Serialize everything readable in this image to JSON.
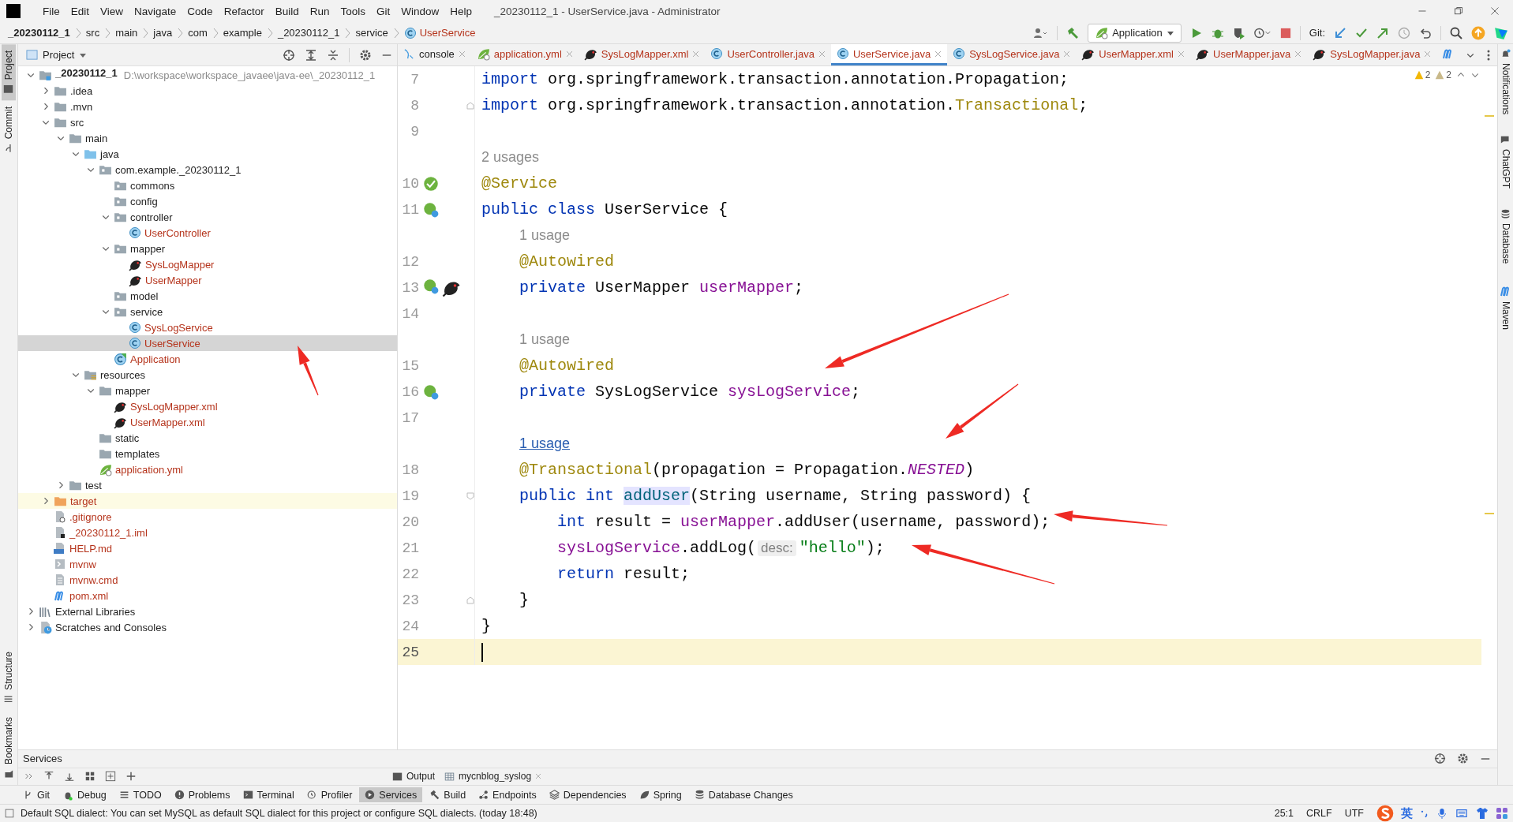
{
  "menu": [
    "File",
    "Edit",
    "View",
    "Navigate",
    "Code",
    "Refactor",
    "Build",
    "Run",
    "Tools",
    "Git",
    "Window",
    "Help"
  ],
  "window": {
    "title": "_20230112_1 - UserService.java - Administrator"
  },
  "breadcrumbs": [
    {
      "label": "_20230112_1",
      "kind": "project"
    },
    {
      "label": "src",
      "kind": "folder"
    },
    {
      "label": "main",
      "kind": "folder"
    },
    {
      "label": "java",
      "kind": "folder"
    },
    {
      "label": "com",
      "kind": "folder"
    },
    {
      "label": "example",
      "kind": "folder"
    },
    {
      "label": "_20230112_1",
      "kind": "folder"
    },
    {
      "label": "service",
      "kind": "folder"
    },
    {
      "label": "UserService",
      "kind": "class"
    }
  ],
  "run_config": {
    "label": "Application"
  },
  "git_label": "Git:",
  "left_toolbar": {
    "top": [
      {
        "label": "Project",
        "selected": true
      },
      {
        "label": "Commit",
        "selected": false
      }
    ],
    "bottom": [
      {
        "label": "Structure",
        "selected": false
      },
      {
        "label": "Bookmarks",
        "selected": false
      }
    ]
  },
  "right_toolbar": [
    {
      "label": "Notifications",
      "kind": "bell"
    },
    {
      "label": "ChatGPT",
      "kind": "chat"
    },
    {
      "label": "Database",
      "kind": "database"
    },
    {
      "label": "Maven",
      "kind": "maven"
    }
  ],
  "project_panel": {
    "title": "Project",
    "tree": [
      {
        "label": "_20230112_1",
        "path": "D:\\workspace\\workspace_javaee\\java-ee\\_20230112_1",
        "kind": "module",
        "expanded": true,
        "selected": false,
        "added": false,
        "children": [
          {
            "label": ".idea",
            "kind": "folder",
            "expanded": false,
            "selected": false,
            "added": false
          },
          {
            "label": ".mvn",
            "kind": "folder",
            "expanded": false,
            "selected": false,
            "added": false
          },
          {
            "label": "src",
            "kind": "folder",
            "expanded": true,
            "selected": false,
            "added": false,
            "children": [
              {
                "label": "main",
                "kind": "folder",
                "expanded": true,
                "selected": false,
                "added": false,
                "children": [
                  {
                    "label": "java",
                    "kind": "source-folder",
                    "expanded": true,
                    "selected": false,
                    "added": false,
                    "children": [
                      {
                        "label": "com.example._20230112_1",
                        "kind": "package",
                        "expanded": true,
                        "selected": false,
                        "added": false,
                        "children": [
                          {
                            "label": "commons",
                            "kind": "package",
                            "selected": false,
                            "added": false
                          },
                          {
                            "label": "config",
                            "kind": "package",
                            "selected": false,
                            "added": false
                          },
                          {
                            "label": "controller",
                            "kind": "package",
                            "expanded": true,
                            "selected": false,
                            "added": false,
                            "children": [
                              {
                                "label": "UserController",
                                "kind": "class",
                                "selected": false,
                                "added": true
                              }
                            ]
                          },
                          {
                            "label": "mapper",
                            "kind": "package",
                            "expanded": true,
                            "selected": false,
                            "added": false,
                            "children": [
                              {
                                "label": "SysLogMapper",
                                "kind": "mybatis",
                                "selected": false,
                                "added": true
                              },
                              {
                                "label": "UserMapper",
                                "kind": "mybatis",
                                "selected": false,
                                "added": true
                              }
                            ]
                          },
                          {
                            "label": "model",
                            "kind": "package",
                            "selected": false,
                            "added": false
                          },
                          {
                            "label": "service",
                            "kind": "package",
                            "expanded": true,
                            "selected": false,
                            "added": false,
                            "children": [
                              {
                                "label": "SysLogService",
                                "kind": "class",
                                "selected": false,
                                "added": true
                              },
                              {
                                "label": "UserService",
                                "kind": "class",
                                "selected": true,
                                "added": true
                              }
                            ]
                          },
                          {
                            "label": "Application",
                            "kind": "spring-class",
                            "selected": false,
                            "added": true
                          }
                        ]
                      }
                    ]
                  },
                  {
                    "label": "resources",
                    "kind": "resources-folder",
                    "expanded": true,
                    "selected": false,
                    "added": false,
                    "children": [
                      {
                        "label": "mapper",
                        "kind": "folder",
                        "expanded": true,
                        "selected": false,
                        "added": false,
                        "children": [
                          {
                            "label": "SysLogMapper.xml",
                            "kind": "mybatis",
                            "selected": false,
                            "added": true
                          },
                          {
                            "label": "UserMapper.xml",
                            "kind": "mybatis",
                            "selected": false,
                            "added": true
                          }
                        ]
                      },
                      {
                        "label": "static",
                        "kind": "folder",
                        "selected": false,
                        "added": false
                      },
                      {
                        "label": "templates",
                        "kind": "folder",
                        "selected": false,
                        "added": false
                      },
                      {
                        "label": "application.yml",
                        "kind": "yml",
                        "selected": false,
                        "added": true
                      }
                    ]
                  }
                ]
              },
              {
                "label": "test",
                "kind": "folder",
                "expanded": false,
                "selected": false,
                "added": false
              }
            ]
          },
          {
            "label": "target",
            "kind": "excluded-folder",
            "expanded": false,
            "selected": false,
            "added": true
          },
          {
            "label": ".gitignore",
            "kind": "ignore-file",
            "selected": false,
            "added": true
          },
          {
            "label": "_20230112_1.iml",
            "kind": "iml-file",
            "selected": false,
            "added": true
          },
          {
            "label": "HELP.md",
            "kind": "md-file",
            "selected": false,
            "added": true
          },
          {
            "label": "mvnw",
            "kind": "script-file",
            "selected": false,
            "added": true
          },
          {
            "label": "mvnw.cmd",
            "kind": "text-file",
            "selected": false,
            "added": true
          },
          {
            "label": "pom.xml",
            "kind": "maven",
            "selected": false,
            "added": true
          }
        ]
      },
      {
        "label": "External Libraries",
        "kind": "libraries",
        "expanded": false,
        "selected": false,
        "added": false
      },
      {
        "label": "Scratches and Consoles",
        "kind": "scratches",
        "expanded": false,
        "selected": false,
        "added": false
      }
    ]
  },
  "tabs": [
    {
      "label": "console",
      "kind": "console",
      "selected": false,
      "added": false
    },
    {
      "label": "application.yml",
      "kind": "yml",
      "selected": false,
      "added": true
    },
    {
      "label": "SysLogMapper.xml",
      "kind": "mybatis",
      "selected": false,
      "added": true
    },
    {
      "label": "UserController.java",
      "kind": "class",
      "selected": false,
      "added": true
    },
    {
      "label": "UserService.java",
      "kind": "class",
      "selected": true,
      "added": true
    },
    {
      "label": "SysLogService.java",
      "kind": "class",
      "selected": false,
      "added": true
    },
    {
      "label": "UserMapper.xml",
      "kind": "mybatis",
      "selected": false,
      "added": true
    },
    {
      "label": "UserMapper.java",
      "kind": "mybatis",
      "selected": false,
      "added": true
    },
    {
      "label": "SysLogMapper.java",
      "kind": "mybatis",
      "selected": false,
      "added": true
    },
    {
      "kind": "maven",
      "selected": false
    }
  ],
  "warnings": [
    {
      "kind": "warning",
      "count": "2"
    },
    {
      "kind": "weak-warning",
      "count": "2"
    }
  ],
  "code": [
    {
      "kind": "code",
      "number": "7",
      "current": false,
      "tokens": [
        {
          "text": "import ",
          "kind": "keyword"
        },
        {
          "text": "org.springframework.transaction.annotation.Propagation;",
          "kind": "plain"
        }
      ]
    },
    {
      "kind": "code",
      "number": "8",
      "current": false,
      "gutter": [
        {
          "kind": "fold-end"
        }
      ],
      "tokens": [
        {
          "text": "import ",
          "kind": "keyword"
        },
        {
          "text": "org.springframework.transaction.annotation.",
          "kind": "plain"
        },
        {
          "text": "Transactional",
          "kind": "annotation"
        },
        {
          "text": ";",
          "kind": "plain"
        }
      ]
    },
    {
      "kind": "code",
      "number": "9",
      "current": false
    },
    {
      "kind": "hint",
      "text": "2 usages",
      "link": false
    },
    {
      "kind": "code",
      "number": "10",
      "current": false,
      "gutter": [
        {
          "kind": "bean"
        }
      ],
      "tokens": [
        {
          "text": "@Service",
          "kind": "annotation"
        }
      ]
    },
    {
      "kind": "code",
      "number": "11",
      "current": false,
      "gutter": [
        {
          "kind": "bean-link"
        }
      ],
      "tokens": [
        {
          "text": "public class ",
          "kind": "keyword"
        },
        {
          "text": "UserService {",
          "kind": "plain"
        }
      ]
    },
    {
      "kind": "hint",
      "text": "1 usage",
      "link": false
    },
    {
      "kind": "code",
      "number": "12",
      "current": false,
      "tokens": [
        {
          "text": "    @Autowired",
          "kind": "annotation"
        }
      ]
    },
    {
      "kind": "code",
      "number": "13",
      "current": false,
      "gutter": [
        {
          "kind": "bean-link"
        },
        {
          "kind": "mybatis"
        }
      ],
      "tokens": [
        {
          "text": "    private ",
          "kind": "keyword"
        },
        {
          "text": "UserMapper ",
          "kind": "plain"
        },
        {
          "text": "userMapper",
          "kind": "field"
        },
        {
          "text": ";",
          "kind": "plain"
        }
      ]
    },
    {
      "kind": "code",
      "number": "14",
      "current": false
    },
    {
      "kind": "hint",
      "text": "1 usage",
      "link": false
    },
    {
      "kind": "code",
      "number": "15",
      "current": false,
      "tokens": [
        {
          "text": "    @Autowired",
          "kind": "annotation"
        }
      ]
    },
    {
      "kind": "code",
      "number": "16",
      "current": false,
      "gutter": [
        {
          "kind": "bean-link"
        }
      ],
      "tokens": [
        {
          "text": "    private ",
          "kind": "keyword"
        },
        {
          "text": "SysLogService ",
          "kind": "plain"
        },
        {
          "text": "sysLogService",
          "kind": "field"
        },
        {
          "text": ";",
          "kind": "plain"
        }
      ]
    },
    {
      "kind": "code",
      "number": "17",
      "current": false
    },
    {
      "kind": "hint",
      "text": "1 usage",
      "link": true
    },
    {
      "kind": "code",
      "number": "18",
      "current": false,
      "tokens": [
        {
          "text": "    @Transactional",
          "kind": "annotation"
        },
        {
          "text": "(propagation = Propagation.",
          "kind": "plain"
        },
        {
          "text": "NESTED",
          "kind": "constant"
        },
        {
          "text": ")",
          "kind": "plain"
        }
      ]
    },
    {
      "kind": "code",
      "number": "19",
      "current": false,
      "gutter": [
        {
          "kind": "fold-start"
        }
      ],
      "tokens": [
        {
          "text": "    public int ",
          "kind": "keyword"
        },
        {
          "text": "addUser",
          "kind": "method-decl"
        },
        {
          "text": "(String username, String password) {",
          "kind": "plain"
        }
      ]
    },
    {
      "kind": "code",
      "number": "20",
      "current": false,
      "tokens": [
        {
          "text": "        int ",
          "kind": "keyword"
        },
        {
          "text": "result = ",
          "kind": "plain"
        },
        {
          "text": "userMapper",
          "kind": "field"
        },
        {
          "text": ".addUser(username, password);",
          "kind": "plain"
        }
      ]
    },
    {
      "kind": "code",
      "number": "21",
      "current": false,
      "tokens": [
        {
          "text": "        sysLogService",
          "kind": "field"
        },
        {
          "text": ".addLog(",
          "kind": "plain"
        },
        {
          "text": "desc:",
          "kind": "param-hint"
        },
        {
          "text": "\"hello\"",
          "kind": "string"
        },
        {
          "text": ");",
          "kind": "plain"
        }
      ]
    },
    {
      "kind": "code",
      "number": "22",
      "current": false,
      "tokens": [
        {
          "text": "        return ",
          "kind": "keyword"
        },
        {
          "text": "result;",
          "kind": "plain"
        }
      ]
    },
    {
      "kind": "code",
      "number": "23",
      "current": false,
      "gutter": [
        {
          "kind": "fold-end"
        }
      ],
      "tokens": [
        {
          "text": "    }",
          "kind": "plain"
        }
      ]
    },
    {
      "kind": "code",
      "number": "24",
      "current": false,
      "tokens": [
        {
          "text": "}",
          "kind": "plain"
        }
      ]
    },
    {
      "kind": "code",
      "number": "25",
      "current": true
    }
  ],
  "services": {
    "title": "Services",
    "tabs": [
      {
        "label": "Output",
        "kind": "output",
        "selected": false
      },
      {
        "label": "mycnblog_syslog",
        "kind": "table",
        "selected": false
      }
    ]
  },
  "tool_windows": [
    {
      "label": "Git",
      "kind": "git",
      "selected": false
    },
    {
      "label": "Debug",
      "kind": "bug",
      "selected": false
    },
    {
      "label": "TODO",
      "kind": "list",
      "selected": false
    },
    {
      "label": "Problems",
      "kind": "info",
      "selected": false
    },
    {
      "label": "Terminal",
      "kind": "terminal",
      "selected": false
    },
    {
      "label": "Profiler",
      "kind": "profiler",
      "selected": false
    },
    {
      "label": "Services",
      "kind": "services",
      "selected": true
    },
    {
      "label": "Build",
      "kind": "hammer",
      "selected": false
    },
    {
      "label": "Endpoints",
      "kind": "endpoints",
      "selected": false
    },
    {
      "label": "Dependencies",
      "kind": "layers",
      "selected": false
    },
    {
      "label": "Spring",
      "kind": "leaf",
      "selected": false
    },
    {
      "label": "Database Changes",
      "kind": "database",
      "selected": false
    }
  ],
  "status_bar": {
    "message": "Default SQL dialect: You can set MySQL as default SQL dialect for this project or configure SQL dialects. (today 18:48)",
    "position": "25:1",
    "line_separator": "CRLF",
    "encoding": "UTF",
    "ime_mode": "英"
  }
}
